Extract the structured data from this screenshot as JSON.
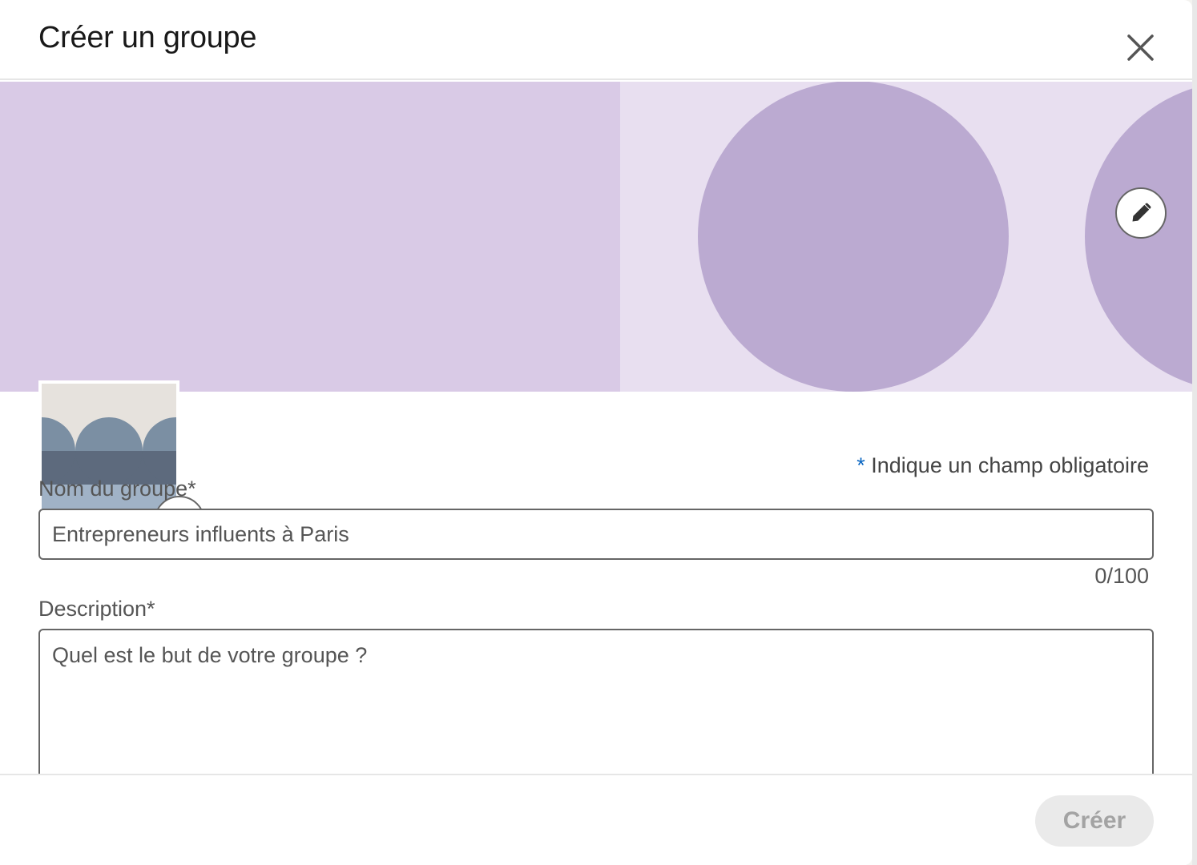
{
  "modal": {
    "title": "Créer un groupe"
  },
  "icons": {
    "close": "close-icon",
    "edit_cover": "pencil-icon",
    "edit_logo": "pencil-icon"
  },
  "colors": {
    "cover_left": "#d9cae6",
    "cover_right": "#e8dff0",
    "cover_circles": "#bbaad1",
    "logo_top": "#e6e2dd",
    "logo_circles": "#7b8fa3",
    "logo_band": "#5d6a7d",
    "logo_bottom": "#a0b2c6",
    "accent_blue": "#0a66c2",
    "button_disabled_bg": "#eaeaea",
    "button_disabled_text": "#a3a3a3"
  },
  "form": {
    "required_star": "*",
    "required_note": "Indique un champ obligatoire",
    "name_label": "Nom du groupe*",
    "name_placeholder": "Entrepreneurs influents à Paris",
    "name_value": "",
    "name_count": "0/100",
    "description_label": "Description*",
    "description_placeholder": "Quel est le but de votre groupe ?",
    "description_value": ""
  },
  "footer": {
    "create_label": "Créer"
  }
}
